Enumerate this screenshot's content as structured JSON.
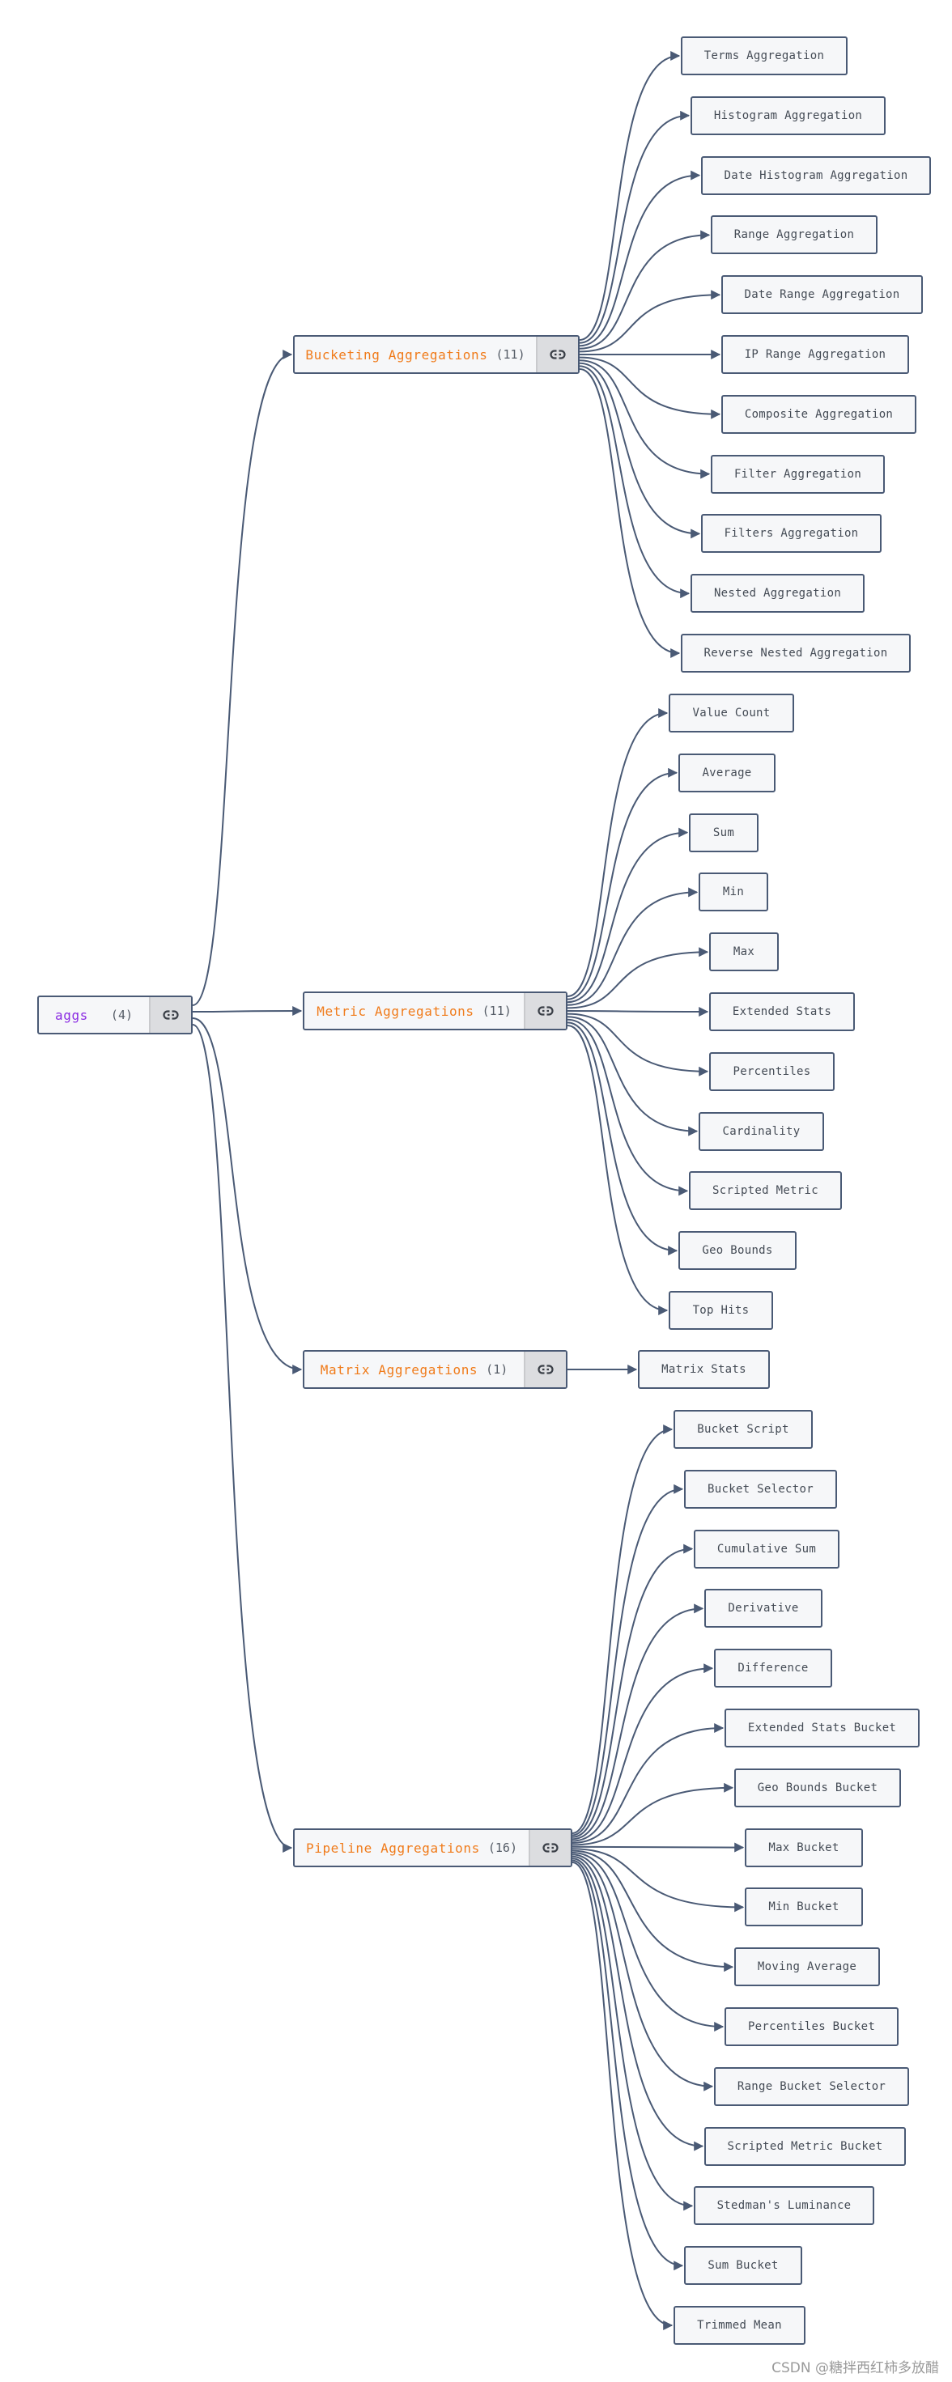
{
  "root": {
    "title": "aggs",
    "count": "(4)",
    "icon": "link-icon"
  },
  "groups": [
    {
      "id": "bucketing",
      "title": "Bucketing Aggregations",
      "count": "(11)",
      "icon": "link-icon",
      "children": [
        "Terms Aggregation",
        "Histogram Aggregation",
        "Date Histogram Aggregation",
        "Range Aggregation",
        "Date Range Aggregation",
        "IP Range Aggregation",
        "Composite Aggregation",
        "Filter Aggregation",
        "Filters Aggregation",
        "Nested Aggregation",
        "Reverse Nested Aggregation"
      ]
    },
    {
      "id": "metric",
      "title": "Metric Aggregations",
      "count": "(11)",
      "icon": "link-icon",
      "children": [
        "Value Count",
        "Average",
        "Sum",
        "Min",
        "Max",
        "Extended Stats",
        "Percentiles",
        "Cardinality",
        "Scripted Metric",
        "Geo Bounds",
        "Top Hits"
      ]
    },
    {
      "id": "matrix",
      "title": "Matrix Aggregations",
      "count": "(1)",
      "icon": "link-icon",
      "children": [
        "Matrix Stats"
      ]
    },
    {
      "id": "pipeline",
      "title": "Pipeline Aggregations",
      "count": "(16)",
      "icon": "link-icon",
      "children": [
        "Bucket Script",
        "Bucket Selector",
        "Cumulative Sum",
        "Derivative",
        "Difference",
        "Extended Stats Bucket",
        "Geo Bounds Bucket",
        "Max Bucket",
        "Min Bucket",
        "Moving Average",
        "Percentiles Bucket",
        "Range Bucket Selector",
        "Scripted Metric Bucket",
        "Stedman's Luminance",
        "Sum Bucket",
        "Trimmed Mean"
      ]
    }
  ],
  "colors": {
    "edge": "#4a5a75",
    "group_title": "#f07b1a",
    "root_title": "#8a2be2",
    "node_bg": "#f6f7f9",
    "icon_bg": "#dcdde0"
  },
  "watermark": "CSDN @糖拌西红柿多放醋"
}
